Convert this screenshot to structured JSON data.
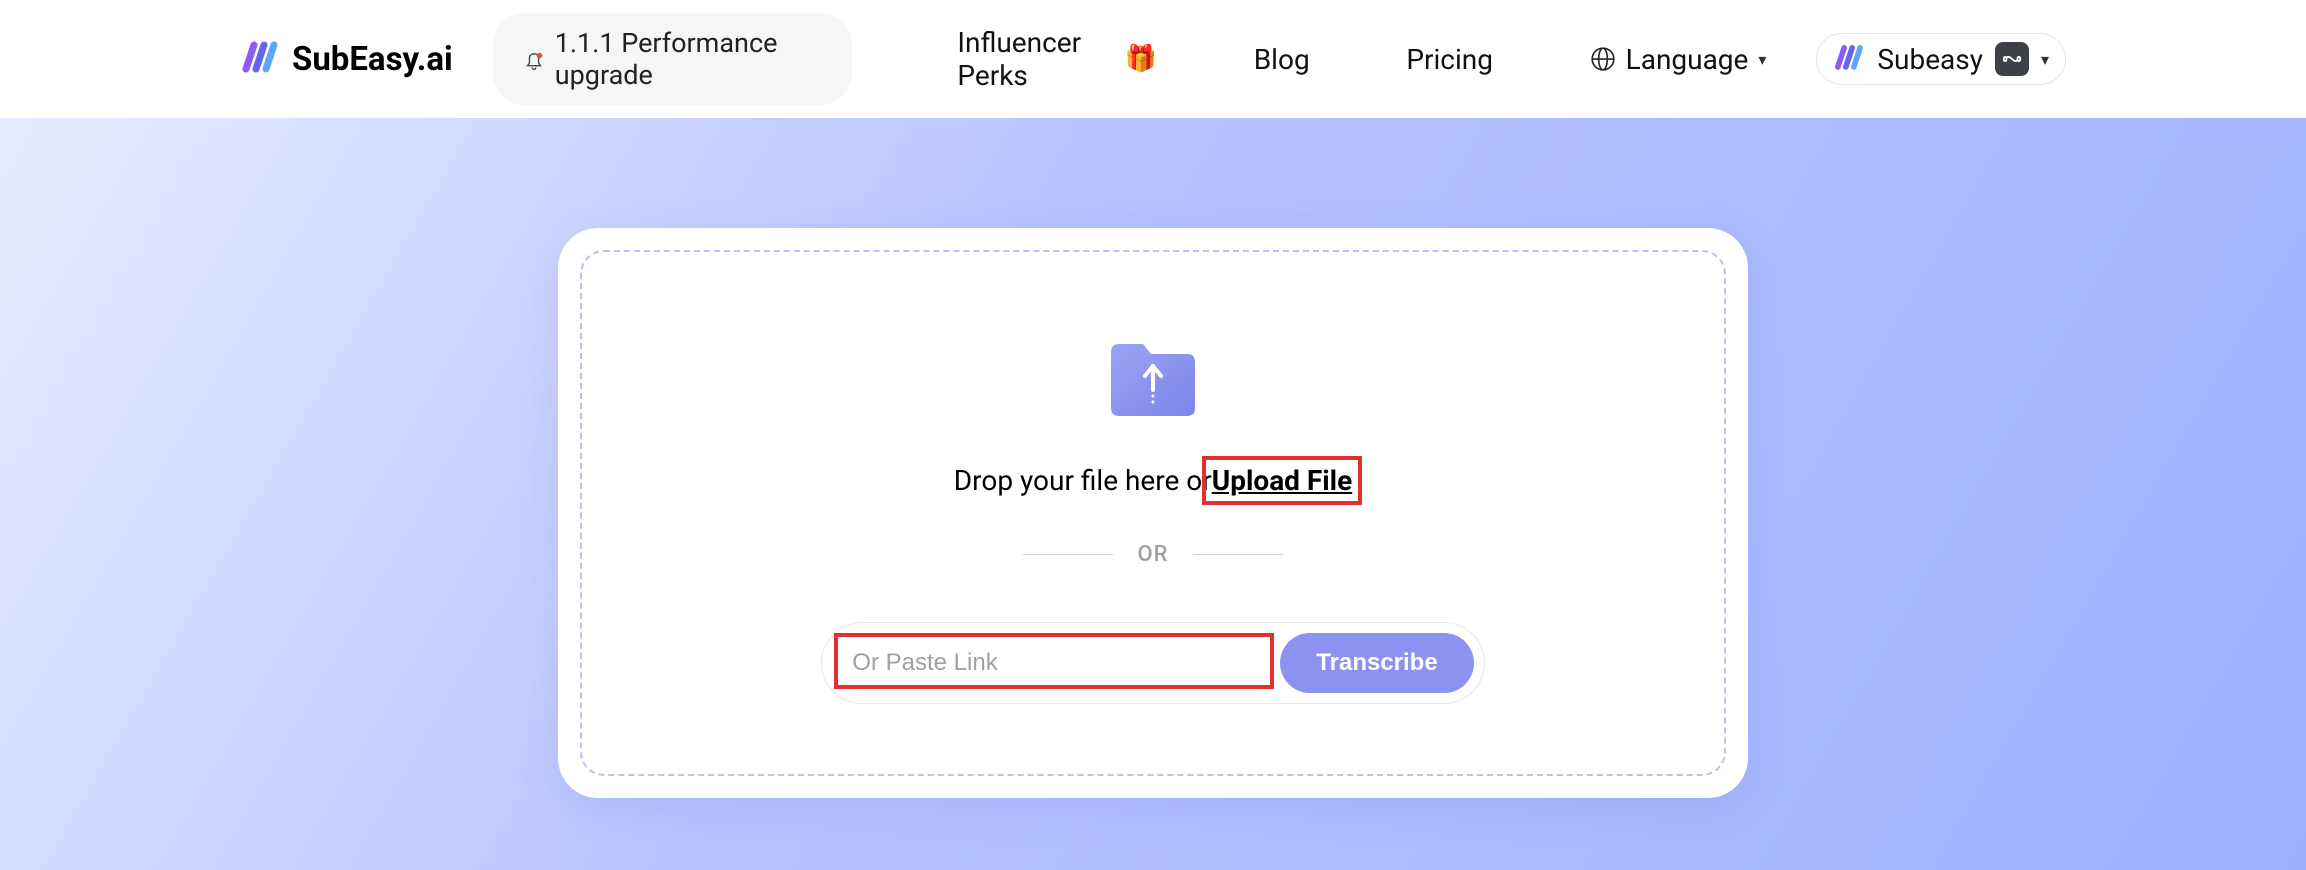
{
  "header": {
    "logo_text": "SubEasy.ai",
    "announcement": "1.1.1 Performance upgrade",
    "nav": {
      "influencer": "Influencer Perks",
      "blog": "Blog",
      "pricing": "Pricing",
      "language": "Language"
    },
    "user": {
      "name": "Subeasy"
    }
  },
  "upload": {
    "drop_text": "Drop your file here or ",
    "upload_link": "Upload File",
    "or": "OR",
    "paste_placeholder": "Or Paste Link",
    "transcribe": "Transcribe"
  }
}
